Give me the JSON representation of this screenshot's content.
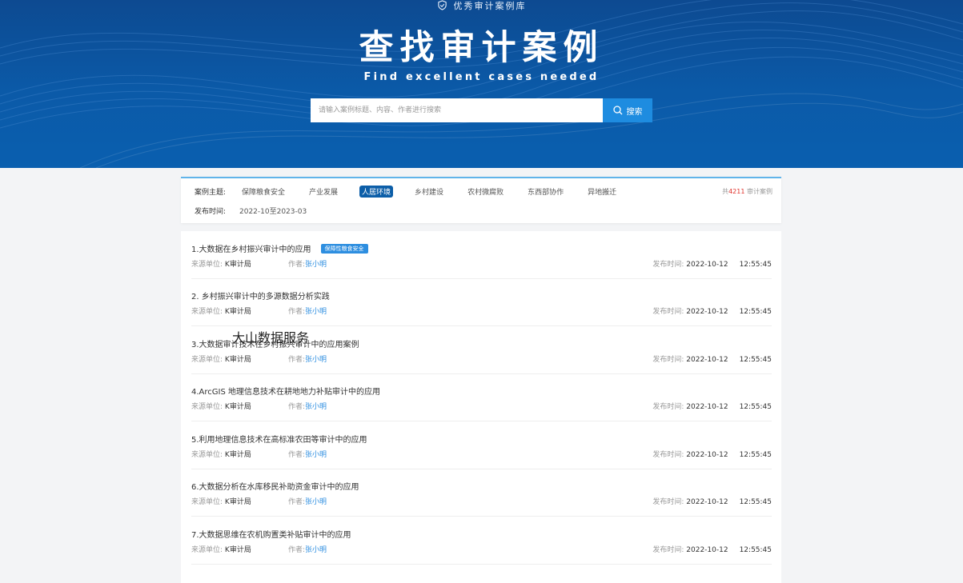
{
  "header": {
    "badge": "优秀审计案例库",
    "title": "查找审计案例",
    "subtitle": "Find excellent cases needed",
    "search_placeholder": "请输入案例标题、内容、作者进行搜索",
    "search_button": "搜索"
  },
  "filters": {
    "topic_label": "案例主题:",
    "topics": [
      "保障粮食安全",
      "产业发展",
      "人居环境",
      "乡村建设",
      "农村微腐败",
      "东西部协作",
      "异地搬迁"
    ],
    "active_topic": "人居环境",
    "date_label": "发布时间:",
    "date_range": "2022-10至2023-03",
    "total_prefix": "共",
    "total_count": "4211",
    "total_suffix": "审计案例"
  },
  "list": {
    "source_label": "来源单位:",
    "author_label": "作者:",
    "date_label": "发布时间:",
    "items": [
      {
        "title": "1.大数据在乡村振兴审计中的应用",
        "tag": "保障性粮食安全",
        "source": "K审计局",
        "author": "张小明",
        "date": "2022-10-12",
        "time": "12:55:45"
      },
      {
        "title": "2. 乡村振兴审计中的多源数据分析实践",
        "source": "K审计局",
        "author": "张小明",
        "date": "2022-10-12",
        "time": "12:55:45"
      },
      {
        "title": "3.大数据审计技术在乡村振兴审计中的应用案例",
        "source": "K审计局",
        "author": "张小明",
        "date": "2022-10-12",
        "time": "12:55:45"
      },
      {
        "title": "4.ArcGIS 地理信息技术在耕地地力补贴审计中的应用",
        "source": "K审计局",
        "author": "张小明",
        "date": "2022-10-12",
        "time": "12:55:45"
      },
      {
        "title": "5.利用地理信息技术在高标准农田等审计中的应用",
        "source": "K审计局",
        "author": "张小明",
        "date": "2022-10-12",
        "time": "12:55:45"
      },
      {
        "title": "6.大数据分析在水库移民补助资金审计中的应用",
        "source": "K审计局",
        "author": "张小明",
        "date": "2022-10-12",
        "time": "12:55:45"
      },
      {
        "title": "7.大数据思维在农机购置类补贴审计中的应用",
        "source": "K审计局",
        "author": "张小明",
        "date": "2022-10-12",
        "time": "12:55:45"
      }
    ]
  },
  "watermark": "大山数据服务",
  "colors": {
    "hero": "#0b5aa8",
    "accent": "#1e8ce0",
    "active_topic": "#0c5ea8",
    "count_red": "#e0302a"
  },
  "icons": [
    "shield-check-icon",
    "search-icon"
  ]
}
